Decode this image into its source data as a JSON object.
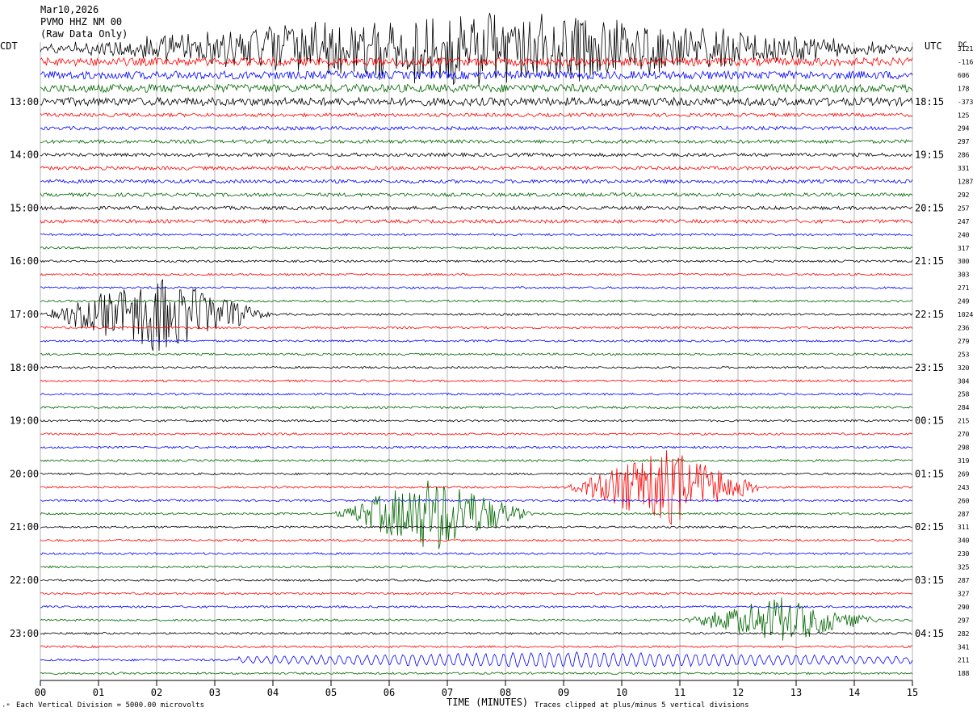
{
  "header": {
    "date": "Mar10,2026",
    "station": "PVMO HHZ NM 00",
    "filter": "(Raw Data Only)"
  },
  "left_axis_label": "CDT",
  "right_axis_label": "UTC",
  "dc_label": "DC",
  "footer": {
    "scale": "Each Vertical Division = 5000.00 microvolts",
    "clip": "Traces clipped at plus/minus 5 vertical divisions",
    "corner": "·\""
  },
  "colors": {
    "black": "#000000",
    "red": "#ff0000",
    "blue": "#0000ff",
    "green": "#006600",
    "grid": "#808080"
  },
  "chart_data": {
    "type": "line",
    "title": "",
    "xlabel": "TIME (MINUTES)",
    "ylabel": "",
    "xlim": [
      0,
      15
    ],
    "x_ticks": [
      "00",
      "01",
      "02",
      "03",
      "04",
      "05",
      "06",
      "07",
      "08",
      "09",
      "10",
      "11",
      "12",
      "13",
      "14",
      "15"
    ],
    "series_color_cycle": [
      "black",
      "red",
      "blue",
      "green"
    ],
    "cdt_hour_labels": [
      "13:00",
      "14:00",
      "15:00",
      "16:00",
      "17:00",
      "18:00",
      "19:00",
      "20:00",
      "21:00",
      "22:00",
      "23:00"
    ],
    "utc_hour_labels": [
      "18:15",
      "19:15",
      "20:15",
      "21:15",
      "22:15",
      "23:15",
      "00:15",
      "01:15",
      "02:15",
      "03:15",
      "04:15"
    ],
    "dc_offsets": [
      "3121",
      "-116",
      "606",
      "178",
      "-373",
      "125",
      "294",
      "297",
      "286",
      "331",
      "1287",
      "292",
      "257",
      "247",
      "240",
      "317",
      "300",
      "303",
      "271",
      "249",
      "1024",
      "236",
      "279",
      "253",
      "320",
      "304",
      "258",
      "284",
      "215",
      "270",
      "298",
      "319",
      "269",
      "243",
      "260",
      "287",
      "311",
      "340",
      "230",
      "325",
      "287",
      "327",
      "290",
      "297",
      "282",
      "341",
      "211",
      "188"
    ],
    "events": [
      {
        "trace_index": 0,
        "start_min": 0.0,
        "end_min": 15.0,
        "amplitude": "clipped"
      },
      {
        "trace_index": 20,
        "start_min": 0.0,
        "end_min": 4.0,
        "amplitude": "clipped"
      },
      {
        "trace_index": 33,
        "start_min": 9.0,
        "end_min": 12.5,
        "amplitude": "clipped"
      },
      {
        "trace_index": 35,
        "start_min": 5.0,
        "end_min": 8.5,
        "amplitude": "clipped"
      },
      {
        "trace_index": 43,
        "start_min": 11.0,
        "end_min": 14.5,
        "amplitude": "high"
      },
      {
        "trace_index": 46,
        "start_min": 3.4,
        "end_min": 15.0,
        "amplitude": "low"
      }
    ]
  }
}
